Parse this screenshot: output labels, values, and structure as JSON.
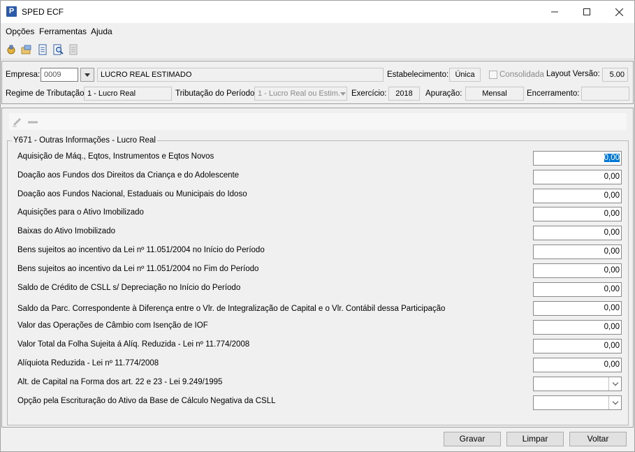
{
  "window": {
    "title": "SPED ECF",
    "minimize": "—",
    "maximize": "☐",
    "close": "✕"
  },
  "menu": {
    "items": [
      {
        "label": "Opções"
      },
      {
        "label": "Ferramentas"
      },
      {
        "label": "Ajuda"
      }
    ]
  },
  "toolbar": {
    "icons": [
      "connect-icon",
      "open-folder-icon",
      "document-icon",
      "search-document-icon",
      "report-icon"
    ]
  },
  "header": {
    "empresa_label": "Empresa:",
    "empresa_code": "0009",
    "empresa_name": "LUCRO REAL ESTIMADO",
    "estabelecimento_label": "Estabelecimento:",
    "estabelecimento_value": "Única",
    "consolidada_label": "Consolidada",
    "layout_label": "Layout Versão:",
    "layout_value": "5.00",
    "regime_label": "Regime de Tributação:",
    "regime_value": "1 - Lucro Real",
    "tributacao_label": "Tributação do Período:",
    "tributacao_value": "1 - Lucro Real ou Estim.",
    "exercicio_label": "Exercício:",
    "exercicio_value": "2018",
    "apuracao_label": "Apuração:",
    "apuracao_value": "Mensal",
    "encerramento_label": "Encerramento:",
    "encerramento_value": ""
  },
  "group": {
    "title": "Y671 - Outras Informações - Lucro Real",
    "rows": [
      {
        "label": "Aquisição de Máq., Eqtos, Instrumentos e Eqtos Novos",
        "value": "0,00"
      },
      {
        "label": "Doação aos Fundos dos Direitos da Criança e do Adolescente",
        "value": "0,00"
      },
      {
        "label": "Doação aos Fundos Nacional, Estaduais ou Municipais do Idoso",
        "value": "0,00"
      },
      {
        "label": "Aquisições para o Ativo Imobilizado",
        "value": "0,00"
      },
      {
        "label": "Baixas do Ativo Imobilizado",
        "value": "0,00"
      },
      {
        "label": "Bens sujeitos ao incentivo da Lei nº 11.051/2004 no Início do Período",
        "value": "0,00"
      },
      {
        "label": "Bens sujeitos ao incentivo da Lei nº 11.051/2004 no Fim do Período",
        "value": "0,00"
      },
      {
        "label": "Saldo de Crédito de CSLL s/ Depreciação no Início do Período",
        "value": "0,00"
      },
      {
        "label": "Saldo da Parc. Correspondente à Diferença entre o Vlr. de Integralização de Capital e o Vlr. Contábil dessa Participação",
        "value": "0,00"
      },
      {
        "label": "Valor das Operações de Câmbio com Isenção de IOF",
        "value": "0,00"
      },
      {
        "label": "Valor Total da Folha Sujeita á Alíq. Reduzida - Lei nº 11.774/2008",
        "value": "0,00"
      },
      {
        "label": "Alíquiota Reduzida - Lei nº 11.774/2008",
        "value": "0,00"
      }
    ],
    "combo_rows": [
      {
        "label": "Alt. de Capital na Forma dos art. 22 e 23 - Lei 9.249/1995",
        "value": ""
      },
      {
        "label": "Opção pela Escrituração do Ativo da Base de Cálculo Negativa da CSLL",
        "value": ""
      }
    ]
  },
  "buttons": {
    "gravar": "Gravar",
    "limpar": "Limpar",
    "voltar": "Voltar"
  }
}
